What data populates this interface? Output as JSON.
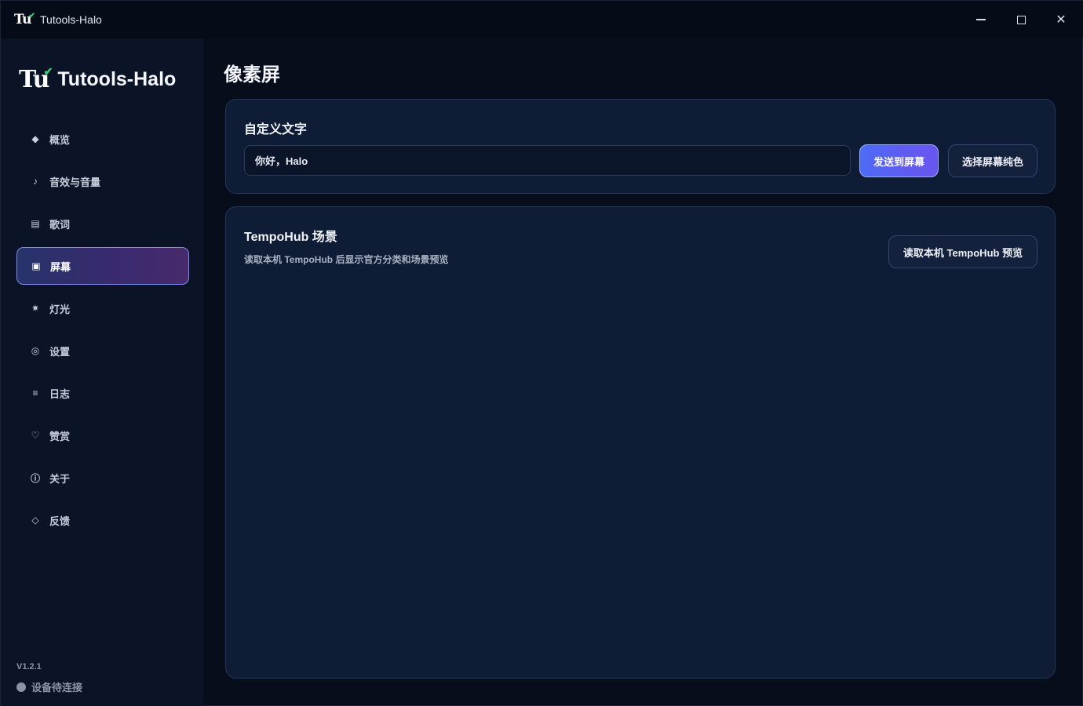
{
  "titlebar": {
    "title": "Tutools-Halo",
    "logo_text": "Tu",
    "minimize_icon": "minimize-icon",
    "maximize_icon": "maximize-icon",
    "close_icon": "close-icon",
    "close_glyph": "✕"
  },
  "sidebar": {
    "brand_logo": "Tu",
    "brand_name": "Tutools-Halo",
    "items": [
      {
        "label": "概览",
        "icon": "diamond-icon",
        "glyph": "◆"
      },
      {
        "label": "音效与音量",
        "icon": "music-note-icon",
        "glyph": "♪"
      },
      {
        "label": "歌词",
        "icon": "lyrics-icon",
        "glyph": "▤"
      },
      {
        "label": "屏幕",
        "icon": "screen-icon",
        "glyph": "▣",
        "active": true
      },
      {
        "label": "灯光",
        "icon": "light-icon",
        "glyph": "✷"
      },
      {
        "label": "设置",
        "icon": "settings-icon",
        "glyph": "◎"
      },
      {
        "label": "日志",
        "icon": "log-icon",
        "glyph": "≡"
      },
      {
        "label": "赞赏",
        "icon": "heart-icon",
        "glyph": "♡"
      },
      {
        "label": "关于",
        "icon": "info-icon",
        "glyph": "ⓘ"
      },
      {
        "label": "反馈",
        "icon": "feedback-icon",
        "glyph": "◇"
      }
    ],
    "version": "V1.2.1",
    "status": "设备待连接"
  },
  "main": {
    "page_title": "像素屏",
    "custom_text_card": {
      "title": "自定义文字",
      "input_value": "你好，Halo",
      "send_button": "发送到屏幕",
      "color_button": "选择屏幕纯色"
    },
    "tempohub_card": {
      "title": "TempoHub 场景",
      "description": "读取本机 TempoHub 后显示官方分类和场景预览",
      "read_button": "读取本机 TempoHub 预览"
    }
  },
  "colors": {
    "accent": "#5f5cf2",
    "active_nav_border": "#7c8cf0",
    "card_bg": "#0f1c35",
    "status_dot": "#8a93a6"
  }
}
